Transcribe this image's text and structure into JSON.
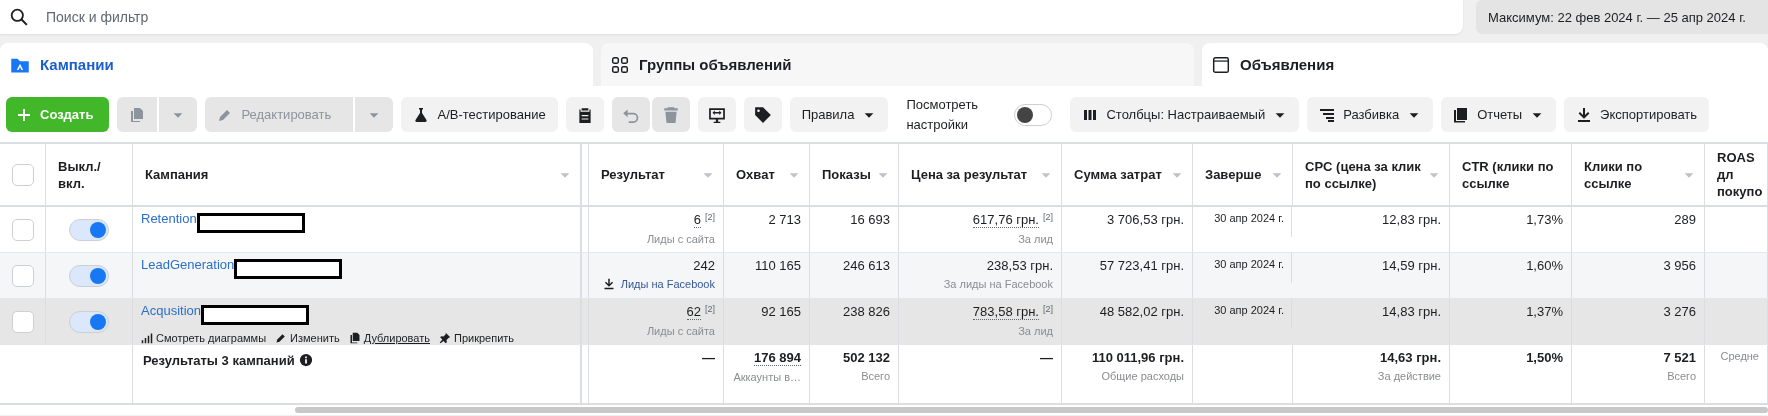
{
  "search": {
    "placeholder": "Поиск и фильтр"
  },
  "date_range": "Максимум: 22 фев 2024 г. — 25 апр 2024 г.",
  "tabs": [
    {
      "label": "Кампании",
      "selected": true
    },
    {
      "label": "Группы объявлений",
      "selected": false
    },
    {
      "label": "Объявления",
      "selected": false
    }
  ],
  "toolbar": [
    {
      "kind": "primary",
      "label": "Создать",
      "disabled": false
    },
    {
      "kind": "split",
      "disabled": true
    },
    {
      "kind": "split",
      "label": "Редактировать",
      "disabled": true
    },
    {
      "kind": "button",
      "label": "A/B-тестирование",
      "disabled": false
    },
    {
      "kind": "icon",
      "disabled": false
    },
    {
      "kind": "icon",
      "disabled": true
    },
    {
      "kind": "icon",
      "disabled": true
    },
    {
      "kind": "icon",
      "disabled": false
    },
    {
      "kind": "icon",
      "disabled": false
    },
    {
      "kind": "dropdown",
      "label": "Правила",
      "disabled": false
    },
    {
      "kind": "switch",
      "label": "Посмотреть настройки",
      "on": false
    },
    {
      "kind": "dropdown",
      "label": "Столбцы: Настраиваемый",
      "disabled": false
    },
    {
      "kind": "dropdown",
      "label": "Разбивка",
      "disabled": false
    },
    {
      "kind": "dropdown",
      "label": "Отчеты",
      "disabled": false
    },
    {
      "kind": "button",
      "label": "Экспортировать",
      "disabled": false
    }
  ],
  "table": {
    "select_all": {
      "checked": false
    },
    "columns": [
      {
        "label": "Выкл./ вкл.",
        "sort": false
      },
      {
        "label": "Кампания",
        "sort": true
      },
      {
        "label": "Результат",
        "sort": true
      },
      {
        "label": "Охват",
        "sort": true
      },
      {
        "label": "Показы",
        "sort": true
      },
      {
        "label": "Цена за результат",
        "sort": true
      },
      {
        "label": "Сумма затрат",
        "sort": true
      },
      {
        "label": "Заверше",
        "sort": true,
        "kind": "date"
      },
      {
        "label": "CPC (цена за клик по ссылке)",
        "sort": true
      },
      {
        "label": "CTR (клики по ссылке",
        "sort": false
      },
      {
        "label": "Клики по ссылке",
        "sort": true
      },
      {
        "label": "ROAS дл покупо",
        "sort": false
      }
    ],
    "rows": [
      {
        "name": "Retention",
        "redacted": true,
        "checked": false,
        "on": true,
        "hovered": false,
        "metrics": [
          {
            "value": "6",
            "note": "[2]",
            "dotted": true,
            "sub": "Лиды с сайта"
          },
          {
            "value": "2 713"
          },
          {
            "value": "16 693"
          },
          {
            "value": "617,76 грн.",
            "note": "[2]",
            "dotted": true,
            "sub": "За лид"
          },
          {
            "value": "3 706,53 грн."
          },
          {
            "value": "30 апр 2024 г."
          },
          {
            "value": "12,83 грн."
          },
          {
            "value": "1,73%"
          },
          {
            "value": "289"
          }
        ]
      },
      {
        "name": "LeadGeneration",
        "redacted": true,
        "checked": false,
        "on": true,
        "hovered": false,
        "metrics": [
          {
            "value": "242",
            "sub": "Лиды на Facebook",
            "sub_link": true
          },
          {
            "value": "110 165"
          },
          {
            "value": "246 613"
          },
          {
            "value": "238,53 грн.",
            "sub": "За лиды на Facebook"
          },
          {
            "value": "57 723,41 грн."
          },
          {
            "value": "30 апр 2024 г."
          },
          {
            "value": "14,59 грн."
          },
          {
            "value": "1,60%"
          },
          {
            "value": "3 956"
          }
        ]
      },
      {
        "name": "Acqusition",
        "redacted": true,
        "checked": false,
        "on": true,
        "hovered": true,
        "actions": [
          {
            "label": "Смотреть диаграммы",
            "underlined": false
          },
          {
            "label": "Изменить",
            "underlined": false
          },
          {
            "label": "Дублировать",
            "underlined": true
          },
          {
            "label": "Прикрепить",
            "underlined": false
          }
        ],
        "metrics": [
          {
            "value": "62",
            "note": "[2]",
            "dotted": true,
            "sub": "Лиды с сайта"
          },
          {
            "value": "92 165"
          },
          {
            "value": "238 826"
          },
          {
            "value": "783,58 грн.",
            "note": "[2]",
            "dotted": true,
            "sub": "За лид"
          },
          {
            "value": "48 582,02 грн."
          },
          {
            "value": "30 апр 2024 г."
          },
          {
            "value": "14,83 грн."
          },
          {
            "value": "1,37%"
          },
          {
            "value": "3 276"
          }
        ]
      }
    ],
    "summary": {
      "label": "Результаты 3 кампаний",
      "metrics": [
        {
          "value": "—"
        },
        {
          "value": "176 894",
          "dotted": true,
          "sub": "Аккаунты в…"
        },
        {
          "value": "502 132",
          "sub": "Всего"
        },
        {
          "value": "—"
        },
        {
          "value": "110 011,96 грн.",
          "sub": "Общие расходы"
        },
        {
          "value": "14,63 грн.",
          "sub": "За действие"
        },
        {
          "value": "1,50%"
        },
        {
          "value": "7 521",
          "sub": "Всего"
        },
        {
          "sub": "Средне"
        }
      ]
    }
  }
}
